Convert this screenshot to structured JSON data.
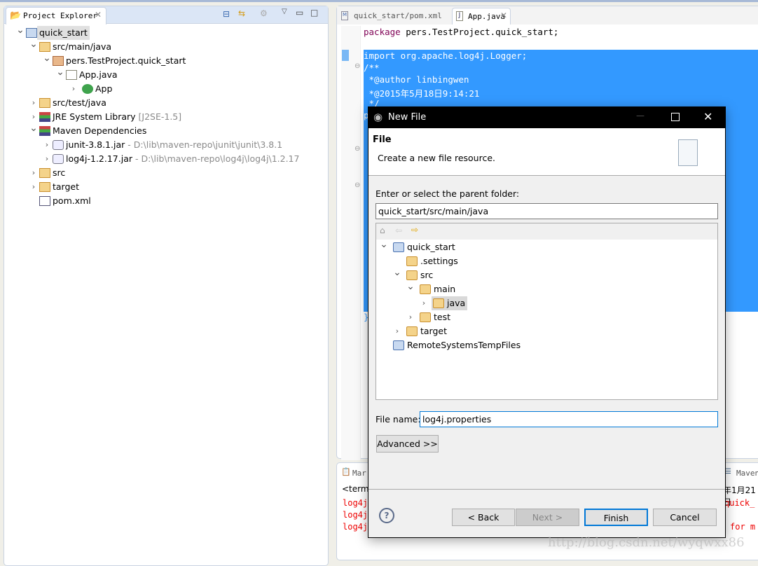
{
  "explorer": {
    "tab_label": "Project Explorer",
    "items": [
      {
        "label": "quick_start",
        "level": 0,
        "chevron": "down",
        "icon": "maven-project-icon",
        "selected": true
      },
      {
        "label": "src/main/java",
        "level": 1,
        "chevron": "down",
        "icon": "source-folder-icon"
      },
      {
        "label": "pers.TestProject.quick_start",
        "level": 2,
        "chevron": "down",
        "icon": "package-icon"
      },
      {
        "label": "App.java",
        "level": 3,
        "chevron": "down",
        "icon": "java-file-icon"
      },
      {
        "label": "App",
        "level": 4,
        "chevron": "right",
        "icon": "class-icon"
      },
      {
        "label": "src/test/java",
        "level": 1,
        "chevron": "right",
        "icon": "source-folder-icon"
      },
      {
        "label": "JRE System Library",
        "suffix": " [J2SE-1.5]",
        "level": 1,
        "chevron": "right",
        "icon": "library-icon"
      },
      {
        "label": "Maven Dependencies",
        "level": 1,
        "chevron": "down",
        "icon": "library-icon"
      },
      {
        "label": "junit-3.8.1.jar",
        "suffix": " - D:\\lib\\maven-repo\\junit\\junit\\3.8.1",
        "level": 2,
        "chevron": "right",
        "icon": "jar-icon"
      },
      {
        "label": "log4j-1.2.17.jar",
        "suffix": " - D:\\lib\\maven-repo\\log4j\\log4j\\1.2.17",
        "level": 2,
        "chevron": "right",
        "icon": "jar-icon"
      },
      {
        "label": "src",
        "level": 1,
        "chevron": "right",
        "icon": "folder-icon"
      },
      {
        "label": "target",
        "level": 1,
        "chevron": "right",
        "icon": "folder-icon"
      },
      {
        "label": "pom.xml",
        "level": 1,
        "chevron": "none",
        "icon": "maven-file-icon"
      }
    ]
  },
  "editor": {
    "tabs": [
      {
        "label": "quick_start/pom.xml",
        "active": false
      },
      {
        "label": "App.java",
        "active": true
      }
    ],
    "lines": [
      "package pers.TestProject.quick_start;",
      "import org.apache.log4j.Logger;",
      "/**",
      " *@author linbingwen",
      " *@2015年5月18日9:14:21",
      " */",
      "p",
      "}"
    ],
    "selection_color": "#3399ff"
  },
  "console": {
    "tabs": [
      "Mar",
      "Maven"
    ],
    "header_left": "<termi",
    "header_right": "年1月21日",
    "lines_left": [
      "log4j",
      "log4j",
      "log4j"
    ],
    "lines_right": [
      "quick_",
      "",
      "for m"
    ]
  },
  "dialog": {
    "title": "New File",
    "heading": "File",
    "description": "Create a new file resource.",
    "folder_label": "Enter or select the parent folder:",
    "folder_value": "quick_start/src/main/java",
    "tree": [
      {
        "label": "quick_start",
        "level": 0,
        "chevron": "down"
      },
      {
        "label": ".settings",
        "level": 1,
        "chevron": "none"
      },
      {
        "label": "src",
        "level": 1,
        "chevron": "down"
      },
      {
        "label": "main",
        "level": 2,
        "chevron": "down"
      },
      {
        "label": "java",
        "level": 3,
        "chevron": "right",
        "selected": true
      },
      {
        "label": "test",
        "level": 2,
        "chevron": "right"
      },
      {
        "label": "target",
        "level": 1,
        "chevron": "right"
      },
      {
        "label": "RemoteSystemsTempFiles",
        "level": 0,
        "chevron": "none"
      }
    ],
    "filename_label": "File name:",
    "filename_value": "log4j.properties",
    "advanced": "Advanced >>",
    "back": "< Back",
    "next": "Next >",
    "finish": "Finish",
    "cancel": "Cancel",
    "accent": "#0078d7"
  },
  "watermark": "http://blog.csdn.net/wyqwxx86"
}
